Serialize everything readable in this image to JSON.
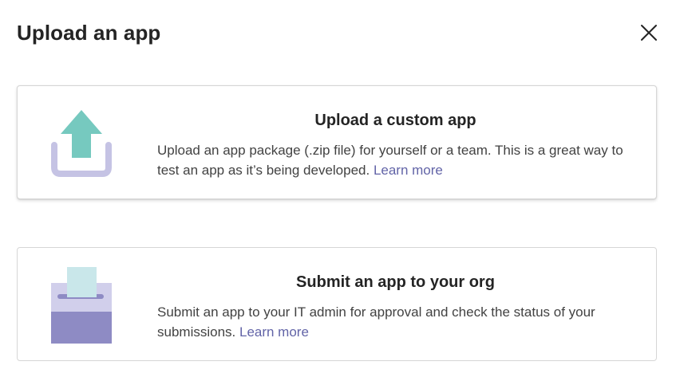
{
  "dialog": {
    "title": "Upload an app",
    "close_icon": "close-icon"
  },
  "cards": [
    {
      "title": "Upload a custom app",
      "description": "Upload an app package (.zip file) for yourself or a team. This is a great way to test an app as it’s being developed.",
      "link": "Learn more",
      "icon": "upload-tray-icon"
    },
    {
      "title": "Submit an app to your org",
      "description": "Submit an app to your IT admin for approval and check the status of your submissions.",
      "link": "Learn more",
      "icon": "submit-ballot-box-icon"
    }
  ],
  "colors": {
    "link": "#6264a7",
    "upload_arrow": "#76c9bf",
    "tray": "#c5c3e4",
    "box_top": "#d1cfeb",
    "box_bottom": "#8e8bc4",
    "paper": "#c9e7ea"
  }
}
